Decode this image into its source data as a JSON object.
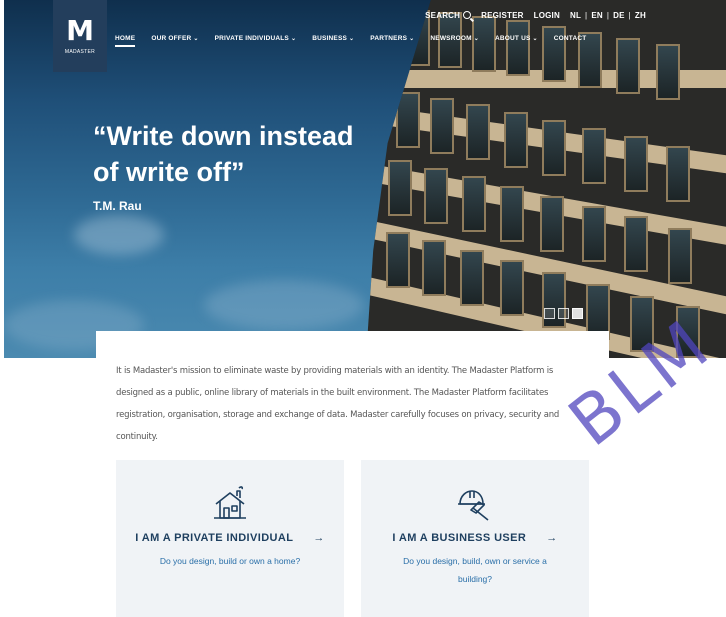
{
  "logo": {
    "mark": "M",
    "text": "MADASTER"
  },
  "utility": {
    "search_label": "SEARCH",
    "register_label": "REGISTER",
    "login_label": "LOGIN",
    "lang_nl": "NL",
    "lang_en": "EN",
    "lang_de": "DE",
    "lang_zh": "ZH",
    "separator": "|"
  },
  "nav": {
    "items": [
      {
        "label": "HOME"
      },
      {
        "label": "OUR OFFER"
      },
      {
        "label": "PRIVATE INDIVIDUALS"
      },
      {
        "label": "BUSINESS"
      },
      {
        "label": "PARTNERS"
      },
      {
        "label": "NEWSROOM"
      },
      {
        "label": "ABOUT US"
      },
      {
        "label": "CONTACT"
      }
    ],
    "chevron": "⌄"
  },
  "hero": {
    "quote": "“Write down instead of write off”",
    "author": "T.M. Rau"
  },
  "slider": {
    "dots": 3,
    "active_index": 2
  },
  "mission": {
    "text": "It is Madaster's mission to eliminate waste by providing materials with an identity. The Madaster Platform is designed as a public, online library of materials in the built environment. The Madaster Platform facilitates registration, organisation, storage and exchange of data. Madaster carefully focuses on privacy, security and continuity."
  },
  "cards": {
    "private": {
      "icon": "house-icon",
      "title": "I AM A PRIVATE INDIVIDUAL",
      "desc": "Do you design, build or own a home?",
      "arrow": "→"
    },
    "business": {
      "icon": "helmet-hammer-icon",
      "title": "I AM A BUSINESS USER",
      "desc": "Do you design, build, own or service a building?",
      "arrow": "→"
    }
  },
  "watermark": {
    "text": "BLM"
  },
  "colors": {
    "primary": "#1e3f5f",
    "logo_bg": "#233e5c",
    "link": "#2a6fa8",
    "card_bg": "#f0f3f6",
    "watermark": "#5046be"
  }
}
